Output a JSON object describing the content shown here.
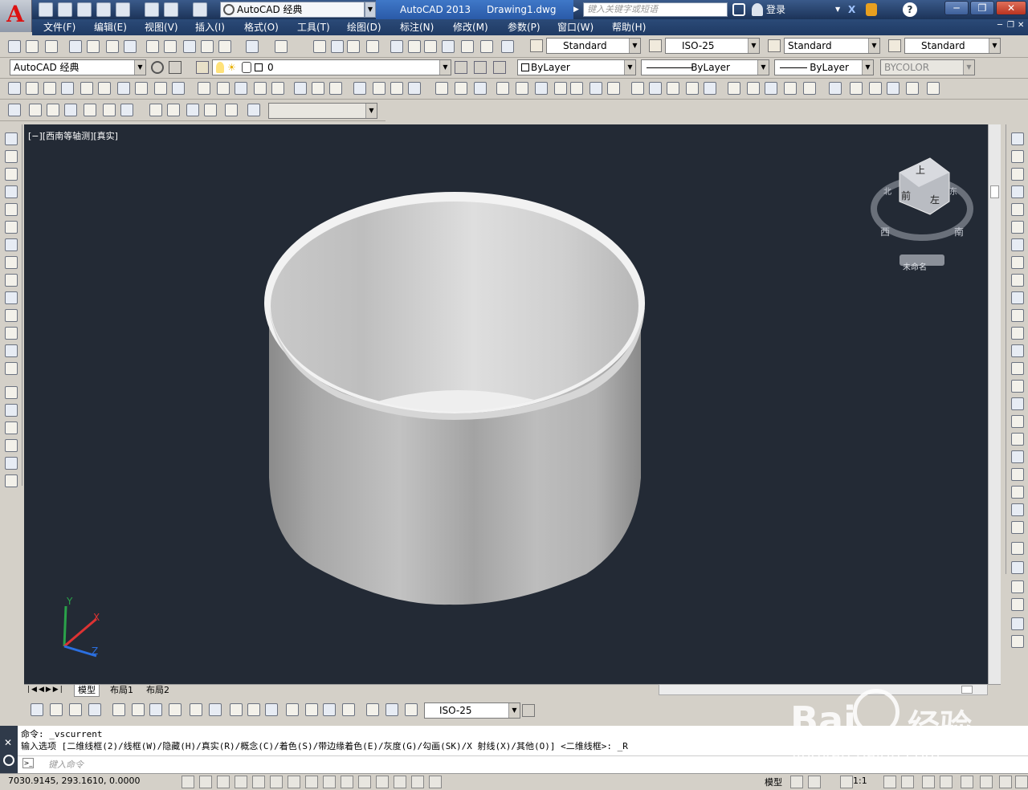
{
  "title_bar": {
    "workspace": "AutoCAD 经典",
    "app_name": "AutoCAD 2013",
    "document": "Drawing1.dwg",
    "search_placeholder": "键入关键字或短语",
    "login": "登录"
  },
  "menu": [
    "文件(F)",
    "编辑(E)",
    "视图(V)",
    "插入(I)",
    "格式(O)",
    "工具(T)",
    "绘图(D)",
    "标注(N)",
    "修改(M)",
    "参数(P)",
    "窗口(W)",
    "帮助(H)"
  ],
  "styles_toolbar": {
    "text_style": "Standard",
    "dim_style": "ISO-25",
    "table_style": "Standard",
    "mleader_style": "Standard"
  },
  "layers_toolbar": {
    "workspace_combo": "AutoCAD 经典",
    "layer_name": "0",
    "color": "ByLayer",
    "linetype": "ByLayer",
    "lineweight": "ByLayer",
    "plotstyle": "BYCOLOR"
  },
  "viewport": {
    "label": "[−][西南等轴测][真实]",
    "viewcube_labels": {
      "top": "上",
      "front": "前",
      "left": "左",
      "west": "西",
      "south": "南",
      "north": "北",
      "east": "东"
    },
    "ucs_name": "未命名",
    "ucs_axes": {
      "x": "X",
      "y": "Y",
      "z": "Z"
    },
    "bg_color": "#232a35"
  },
  "layout_tabs": [
    "模型",
    "布局1",
    "布局2"
  ],
  "dim_toolbar": {
    "dim_style": "ISO-25"
  },
  "command_line": {
    "line1": "命令: _vscurrent",
    "line2": "输入选项 [二维线框(2)/线框(W)/隐藏(H)/真实(R)/概念(C)/着色(S)/带边缘着色(E)/灰度(G)/勾画(SK)/X 射线(X)/其他(O)] <二维线框>: _R",
    "input_placeholder": "键入命令"
  },
  "status_bar": {
    "coords": "7030.9145, 293.1610, 0.0000",
    "model_label": "模型",
    "scale": "1:1"
  },
  "watermark": {
    "brand": "Bai",
    "brand_cn": "经验",
    "url": "jingyan.baidu.com"
  }
}
